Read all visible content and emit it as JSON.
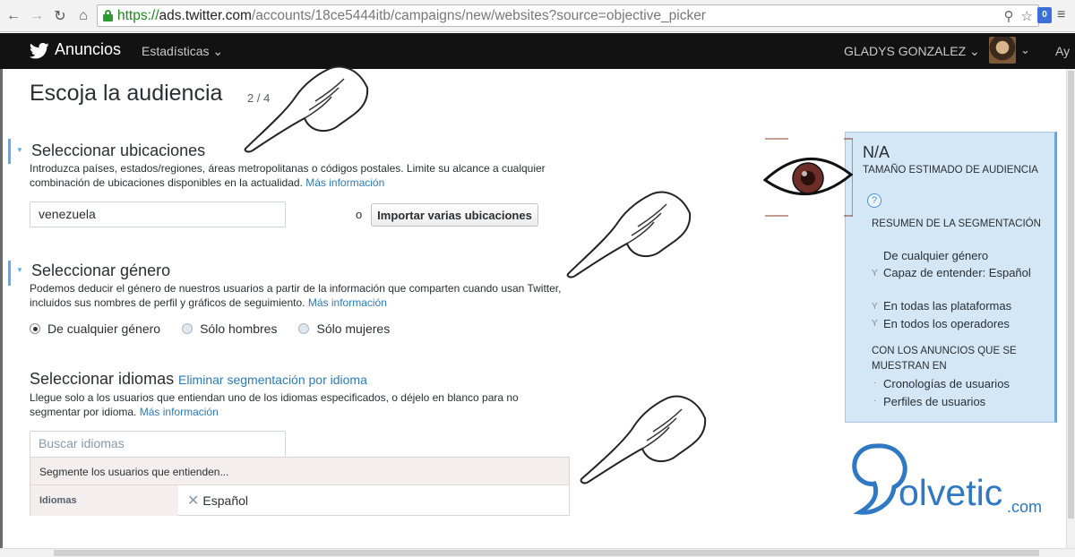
{
  "browser": {
    "url_scheme": "https://",
    "url_host": "ads.twitter.com",
    "url_path": "/accounts/18ce5444itb/campaigns/new/websites?source=objective_picker"
  },
  "topbar": {
    "brand": "Anuncios",
    "stats": "Estadísticas",
    "user": "GLADYS GONZALEZ",
    "help": "Ay"
  },
  "page": {
    "title": "Escoja la audiencia",
    "step": "2 / 4"
  },
  "locations": {
    "title": "Seleccionar ubicaciones",
    "desc": "Introduzca países, estados/regiones, áreas metropolitanas o códigos postales. Limite su alcance a cualquier combinación de ubicaciones disponibles en la actualidad.",
    "more": "Más información",
    "input_value": "venezuela",
    "or": "o",
    "import_button": "Importar varias ubicaciones"
  },
  "gender": {
    "title": "Seleccionar género",
    "desc": "Podemos deducir el género de nuestros usuarios a partir de la información que comparten cuando usan Twitter, incluidos sus nombres de perfil y gráficos de seguimiento.",
    "more": "Más información",
    "options": [
      "De cualquier género",
      "Sólo hombres",
      "Sólo mujeres"
    ],
    "selected": "De cualquier género"
  },
  "languages": {
    "title": "Seleccionar idiomas",
    "remove_link": "Eliminar segmentación por idioma",
    "desc": "Llegue solo a los usuarios que entiendan uno de los idiomas especificados, o déjelo en blanco para no segmentar por idioma.",
    "more": "Más información",
    "search_placeholder": "Buscar idiomas",
    "panel_header": "Segmente los usuarios que entienden...",
    "row_label": "Idiomas",
    "row_value": "Español"
  },
  "audience": {
    "estimate": "N/A",
    "estimate_caption": "TAMAÑO ESTIMADO DE AUDIENCIA",
    "help": "?",
    "summary_title": "RESUMEN DE LA SEGMENTACIÓN",
    "summary_items": [
      "De cualquier género",
      "Capaz de entender: Español",
      "En todas las plataformas",
      "En todos los operadores"
    ],
    "summary_bullet": "Y",
    "shown_title": "CON LOS ANUNCIOS QUE SE MUESTRAN EN",
    "shown_items": [
      "Cronologías de usuarios",
      "Perfiles de usuarios"
    ],
    "shown_bullet": "·"
  },
  "watermark": {
    "text": "olvetic",
    "suffix": ".com"
  },
  "colors": {
    "accent": "#55acee",
    "link": "#2b7bb9",
    "topbar": "#121212",
    "panel": "#d4e7f7"
  }
}
